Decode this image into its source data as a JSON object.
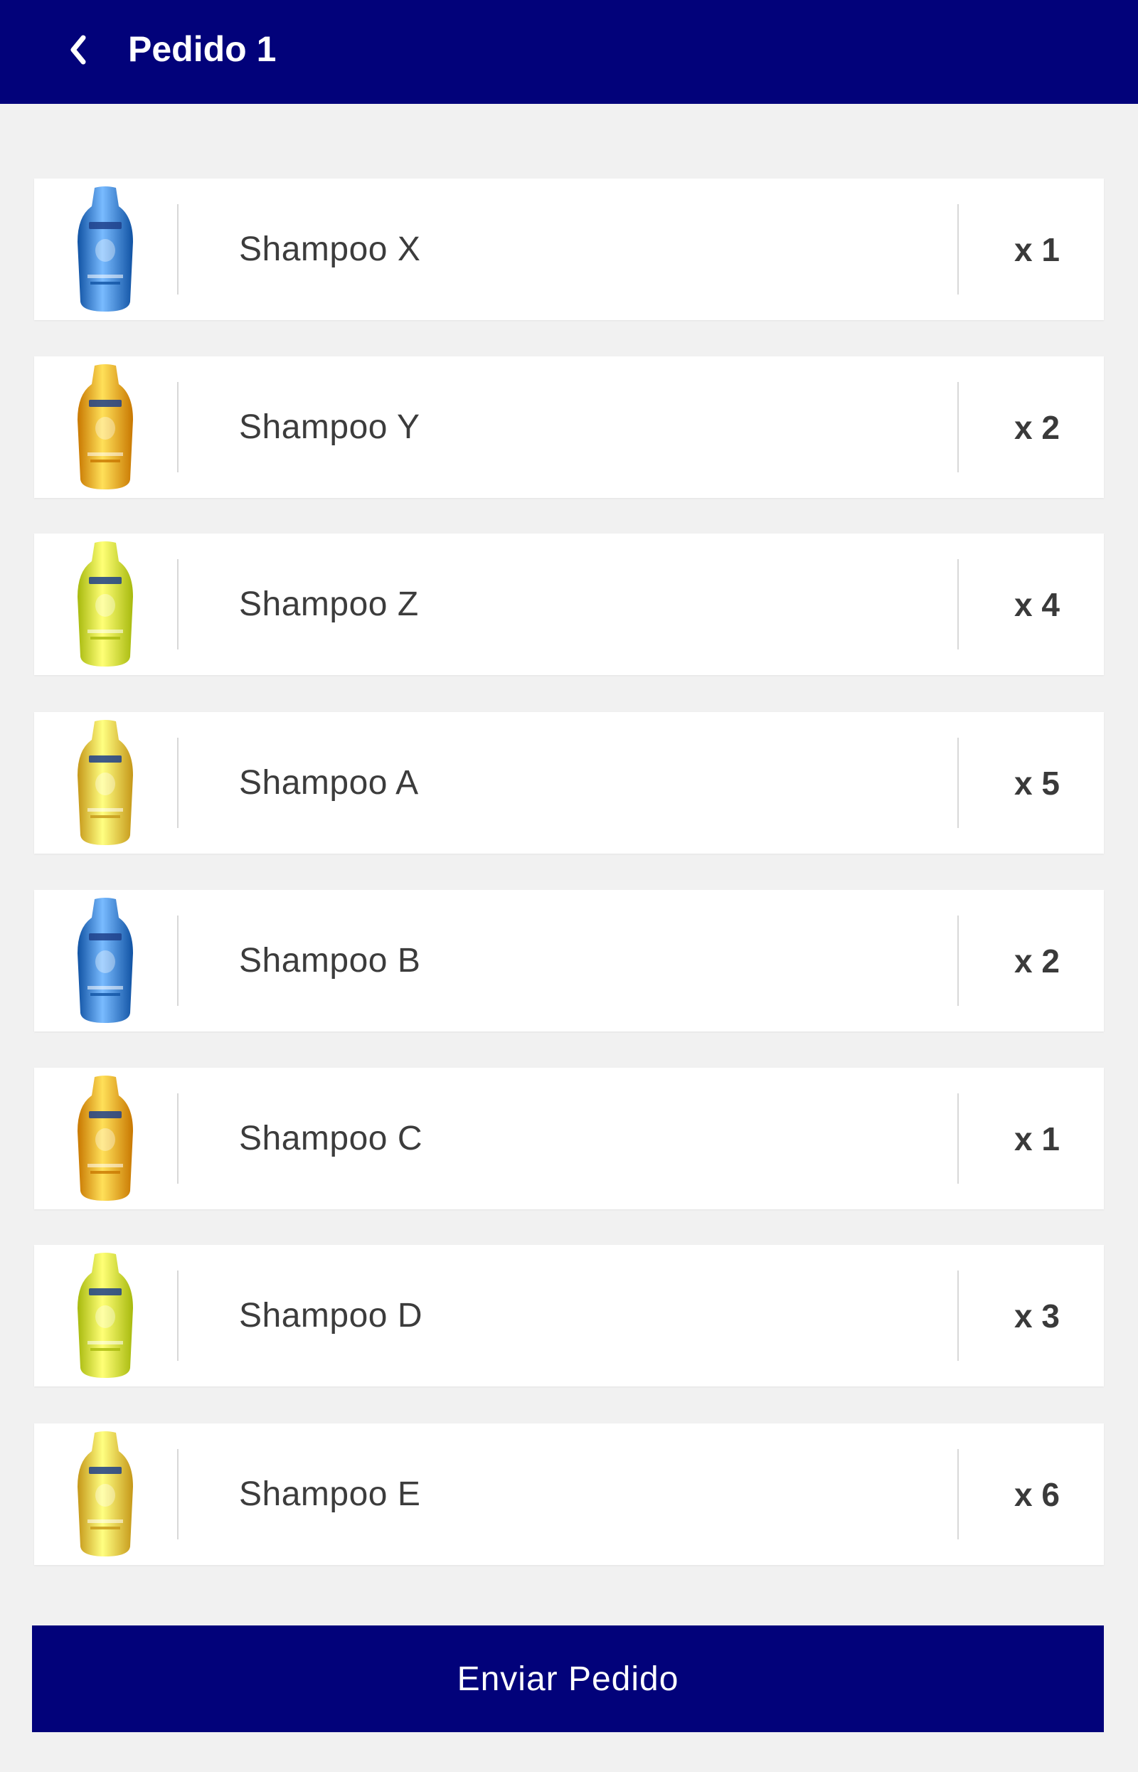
{
  "header": {
    "back_icon": "chevron-left-icon",
    "title": "Pedido 1"
  },
  "items": [
    {
      "name": "Shampoo X",
      "qty": "x 1",
      "color": "blue"
    },
    {
      "name": "Shampoo Y",
      "qty": "x 2",
      "color": "orange"
    },
    {
      "name": "Shampoo Z",
      "qty": "x 4",
      "color": "lime"
    },
    {
      "name": "Shampoo A",
      "qty": "x 5",
      "color": "honey"
    },
    {
      "name": "Shampoo B",
      "qty": "x 2",
      "color": "blue"
    },
    {
      "name": "Shampoo C",
      "qty": "x 1",
      "color": "orange"
    },
    {
      "name": "Shampoo D",
      "qty": "x 3",
      "color": "lime"
    },
    {
      "name": "Shampoo E",
      "qty": "x 6",
      "color": "honey"
    }
  ],
  "palette": {
    "header_bg": "#02027a",
    "blue": "#3d7fd0",
    "orange": "#f5a41d",
    "lime": "#d4e63a",
    "honey": "#f2c445"
  },
  "footer": {
    "send_label": "Enviar Pedido"
  }
}
